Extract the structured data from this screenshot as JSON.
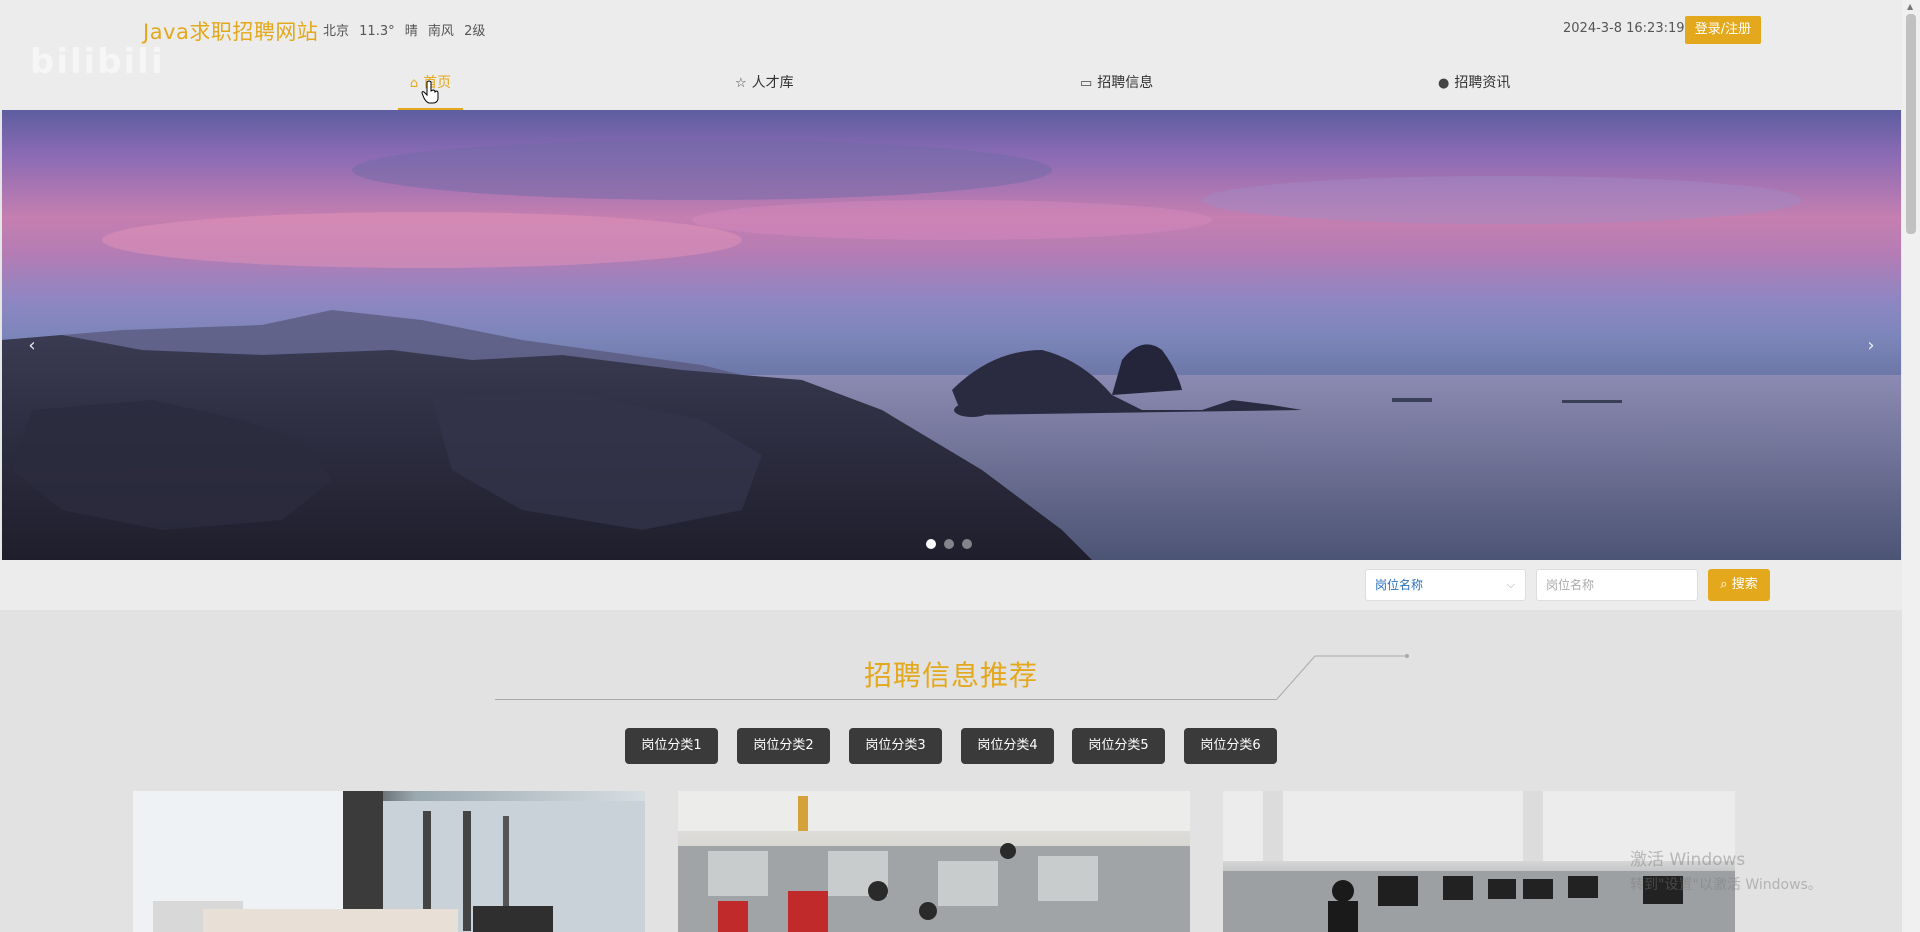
{
  "header": {
    "site_title": "Java求职招聘网站",
    "weather": {
      "city": "北京",
      "temp": "11.3°",
      "condition": "晴",
      "wind": "南风",
      "level": "2级"
    },
    "datetime": "2024-3-8 16:23:19",
    "login_label": "登录/注册"
  },
  "nav": {
    "items": [
      {
        "label": "首页",
        "icon": "home-icon"
      },
      {
        "label": "人才库",
        "icon": "star-icon"
      },
      {
        "label": "招聘信息",
        "icon": "bag-icon"
      },
      {
        "label": "招聘资讯",
        "icon": "alert-icon"
      }
    ]
  },
  "banner": {
    "prev": "‹",
    "next": "›",
    "slides": 3,
    "active_slide": 1
  },
  "search": {
    "select_value": "岗位名称",
    "input_placeholder": "岗位名称",
    "button_label": "搜索"
  },
  "recommend": {
    "title": "招聘信息推荐",
    "categories": [
      "岗位分类1",
      "岗位分类2",
      "岗位分类3",
      "岗位分类4",
      "岗位分类5",
      "岗位分类6"
    ]
  },
  "overlay": {
    "watermark": "bilibili",
    "windows_title": "激活 Windows",
    "windows_sub": "转到\"设置\"以激活 Windows。"
  },
  "colors": {
    "accent": "#e3a81c",
    "category_bg": "#3a3a3a"
  }
}
